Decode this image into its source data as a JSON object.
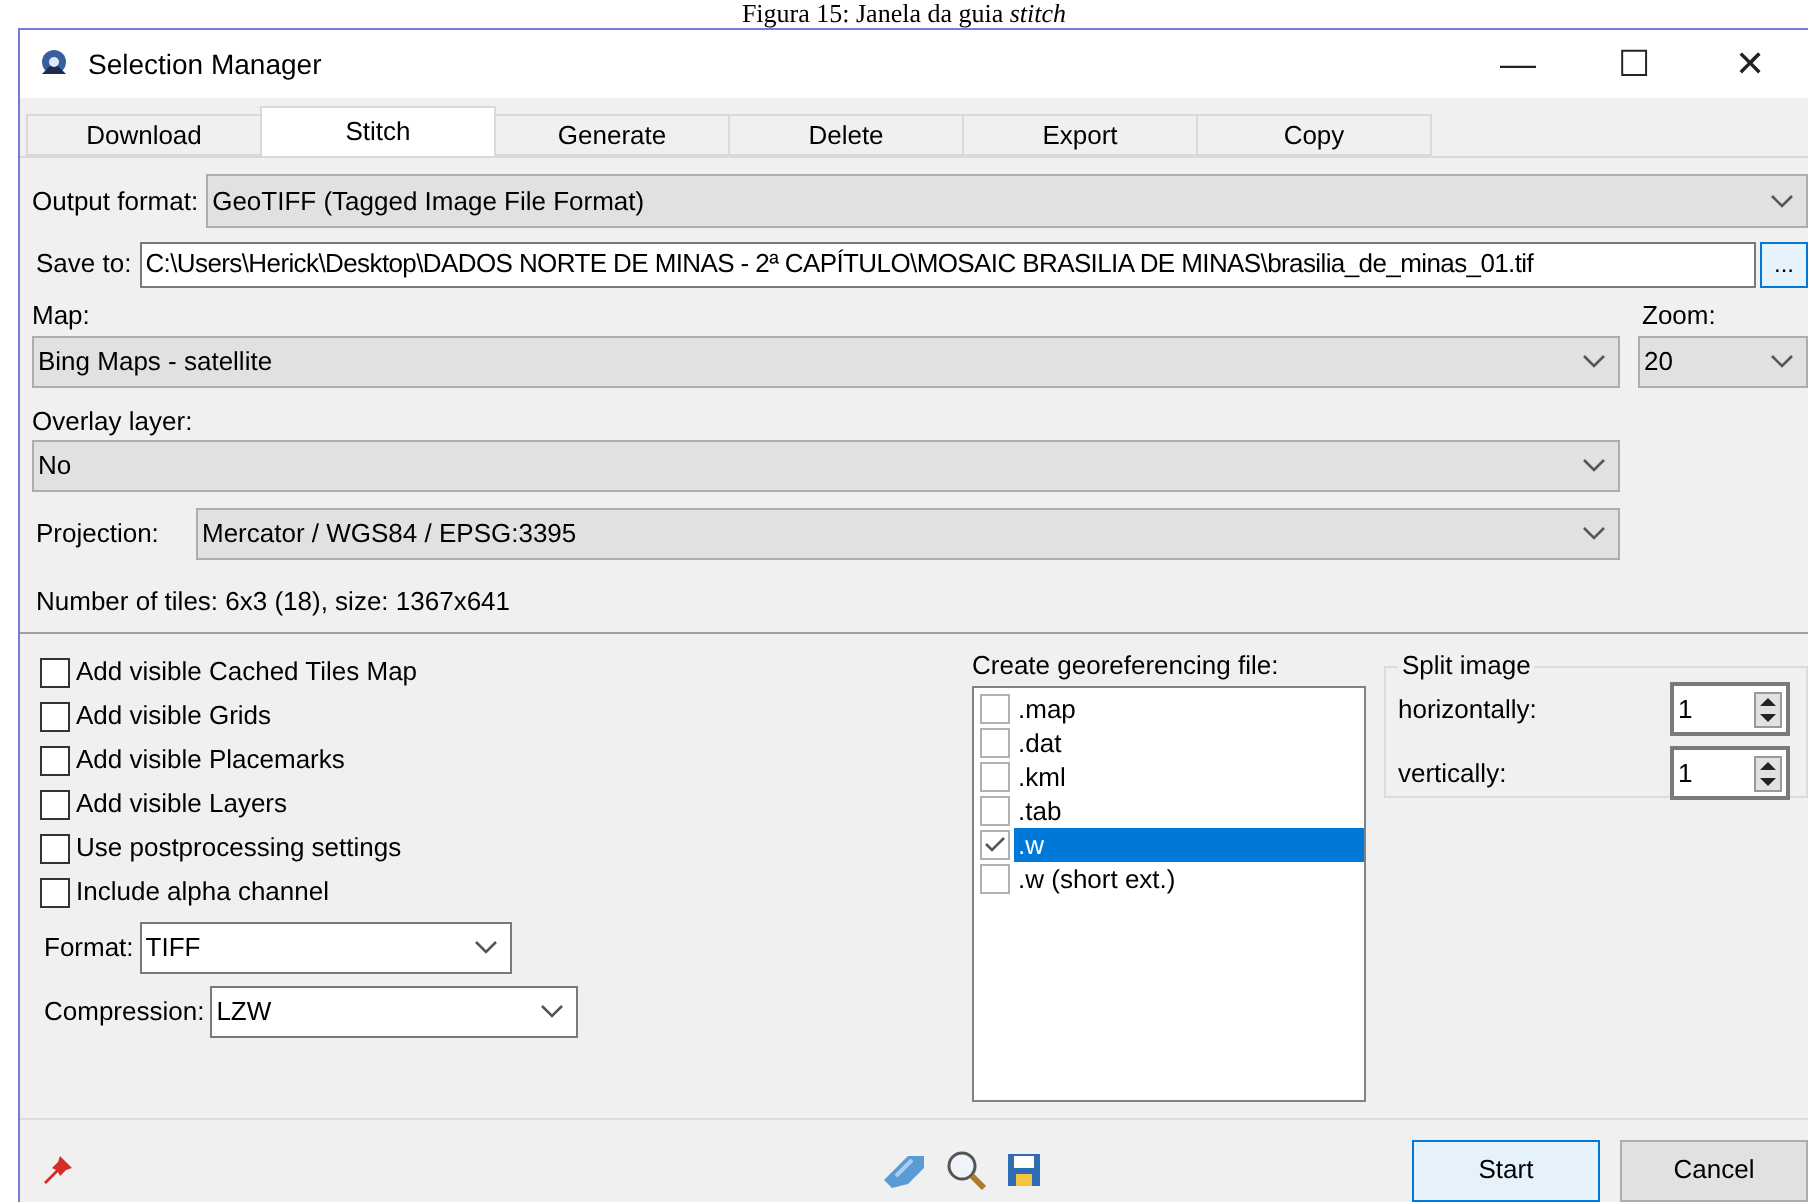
{
  "caption": "Figura 15: Janela da guia *stitch*",
  "window": {
    "title": "Selection Manager",
    "controls": [
      "—",
      "☐",
      "✕"
    ]
  },
  "tabs": [
    {
      "label": "Download",
      "selected": false
    },
    {
      "label": "Stitch",
      "selected": true
    },
    {
      "label": "Generate",
      "selected": false
    },
    {
      "label": "Delete",
      "selected": false
    },
    {
      "label": "Export",
      "selected": false
    },
    {
      "label": "Copy",
      "selected": false
    }
  ],
  "output_format": {
    "label": "Output format:",
    "value": "GeoTIFF (Tagged Image File Format)"
  },
  "save_to": {
    "label": "Save to:",
    "value": "C:\\Users\\Herick\\Desktop\\DADOS NORTE DE MINAS - 2ª CAPÍTULO\\MOSAIC BRASILIA DE MINAS\\brasilia_de_minas_01.tif",
    "browse": "..."
  },
  "map": {
    "label": "Map:",
    "value": "Bing Maps - satellite"
  },
  "zoom": {
    "label": "Zoom:",
    "value": "20"
  },
  "overlay_layer": {
    "label": "Overlay layer:",
    "value": "No"
  },
  "projection": {
    "label": "Projection:",
    "value": "Mercator / WGS84 / EPSG:3395"
  },
  "tiles_info": "Number of tiles: 6x3 (18), size: 1367x641",
  "options": [
    {
      "label": "Add visible Cached Tiles Map",
      "checked": false
    },
    {
      "label": "Add visible Grids",
      "checked": false
    },
    {
      "label": "Add visible Placemarks",
      "checked": false
    },
    {
      "label": "Add visible Layers",
      "checked": false
    },
    {
      "label": "Use postprocessing settings",
      "checked": false
    },
    {
      "label": "Include alpha channel",
      "checked": false
    }
  ],
  "format": {
    "label": "Format:",
    "value": "TIFF"
  },
  "compression": {
    "label": "Compression:",
    "value": "LZW"
  },
  "georeferencing": {
    "label": "Create georeferencing file:",
    "items": [
      {
        "label": ".map",
        "checked": false,
        "selected": false
      },
      {
        "label": ".dat",
        "checked": false,
        "selected": false
      },
      {
        "label": ".kml",
        "checked": false,
        "selected": false
      },
      {
        "label": ".tab",
        "checked": false,
        "selected": false
      },
      {
        "label": ".w",
        "checked": true,
        "selected": true
      },
      {
        "label": ".w (short ext.)",
        "checked": false,
        "selected": false
      }
    ]
  },
  "split_image": {
    "title": "Split image",
    "rows": [
      {
        "label": "horizontally:",
        "value": "1"
      },
      {
        "label": "vertically:",
        "value": "1"
      }
    ]
  },
  "buttons": [
    {
      "label": "Start",
      "selected": true
    },
    {
      "label": "Cancel",
      "selected": false
    }
  ]
}
